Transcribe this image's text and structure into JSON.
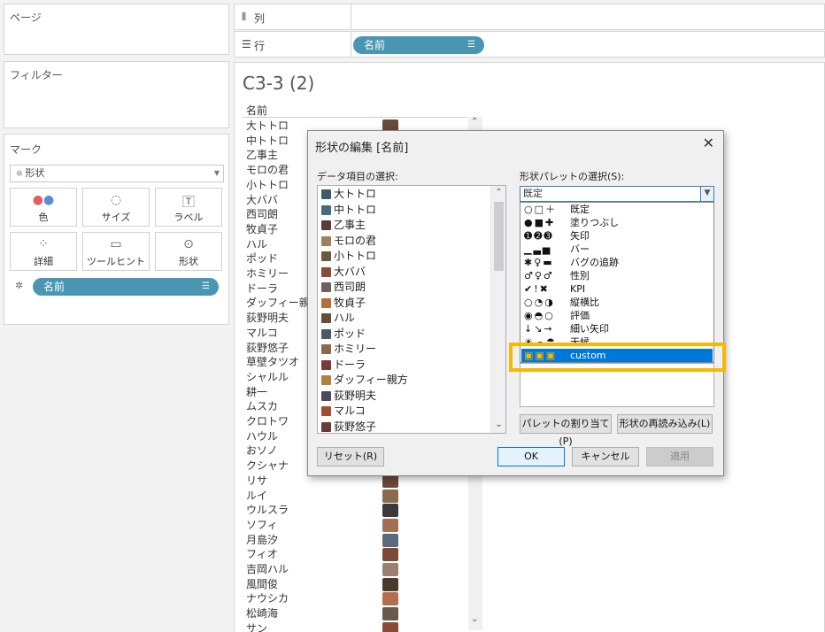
{
  "panels": {
    "pages_title": "ページ",
    "filters_title": "フィルター",
    "marks_title": "マーク",
    "mark_type": "形状",
    "mark_buttons": [
      {
        "label": "色",
        "icon": "color-dots-icon"
      },
      {
        "label": "サイズ",
        "icon": "size-icon"
      },
      {
        "label": "ラベル",
        "icon": "label-icon"
      },
      {
        "label": "詳細",
        "icon": "detail-icon"
      },
      {
        "label": "ツールヒント",
        "icon": "tooltip-icon"
      },
      {
        "label": "形状",
        "icon": "shape-icon"
      }
    ],
    "mark_pill": "名前"
  },
  "shelves": {
    "columns_label": "列",
    "rows_label": "行",
    "rows_pill": "名前"
  },
  "view": {
    "title": "C3-3 (2)",
    "header": "名前",
    "names": [
      "大トトロ",
      "中トトロ",
      "乙事主",
      "モロの君",
      "小トトロ",
      "大ババ",
      "西司朗",
      "牧貞子",
      "ハル",
      "ポッド",
      "ホミリー",
      "ドーラ",
      "ダッフィー親方",
      "荻野明夫",
      "マルコ",
      "荻野悠子",
      "草壁タツオ",
      "シャルル",
      "耕一",
      "ムスカ",
      "クロトワ",
      "ハウル",
      "おソノ",
      "クシャナ",
      "リサ",
      "ルイ",
      "ウルスラ",
      "ソフィ",
      "月島汐",
      "フィオ",
      "吉岡ハル",
      "風間俊",
      "ナウシカ",
      "松崎海",
      "サン"
    ]
  },
  "dialog": {
    "title": "形状の編集 [名前]",
    "data_items_label": "データ項目の選択:",
    "data_items": [
      "大トトロ",
      "中トトロ",
      "乙事主",
      "モロの君",
      "小トトロ",
      "大ババ",
      "西司朗",
      "牧貞子",
      "ハル",
      "ポッド",
      "ホミリー",
      "ドーラ",
      "ダッフィー親方",
      "荻野明夫",
      "マルコ",
      "荻野悠子"
    ],
    "palette_label": "形状パレットの選択(S):",
    "palette_value": "既定",
    "palette_options": [
      {
        "glyphs": "○□＋",
        "label": "既定"
      },
      {
        "glyphs": "●■✚",
        "label": "塗りつぶし"
      },
      {
        "glyphs": "➊➋➌",
        "label": "矢印"
      },
      {
        "glyphs": "▁▃▅",
        "label": "バー"
      },
      {
        "glyphs": "✱♀▬",
        "label": "バグの追跡"
      },
      {
        "glyphs": "♂♀♂",
        "label": "性別"
      },
      {
        "glyphs": "✔!✖",
        "label": "KPI"
      },
      {
        "glyphs": "○◔◑",
        "label": "縦横比"
      },
      {
        "glyphs": "◉◓○",
        "label": "評価"
      },
      {
        "glyphs": "↓↘→",
        "label": "細い矢印"
      },
      {
        "glyphs": "☀☁☂",
        "label": "天候"
      },
      {
        "glyphs": "▣▣▣",
        "label": "custom"
      }
    ],
    "assign_palette": "パレットの割り当て(P)",
    "reload_shapes": "形状の再読み込み(L)",
    "reset": "リセット(R)",
    "ok": "OK",
    "cancel": "キャンセル",
    "apply": "適用"
  }
}
